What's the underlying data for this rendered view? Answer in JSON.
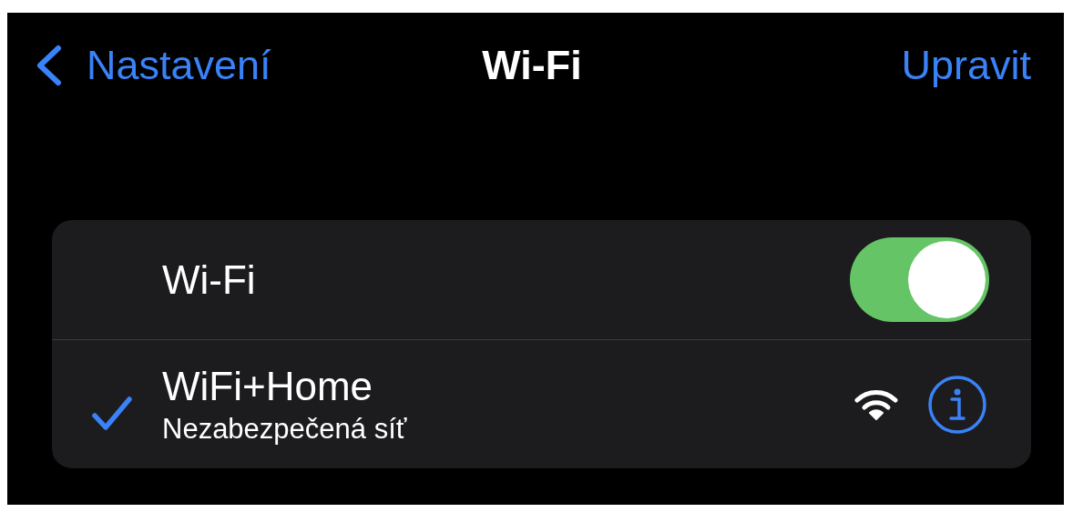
{
  "nav": {
    "back_label": "Nastavení",
    "title": "Wi-Fi",
    "action_label": "Upravit"
  },
  "wifi_toggle": {
    "label": "Wi-Fi",
    "on": true
  },
  "networks": [
    {
      "name": "WiFi+Home",
      "subtitle": "Nezabezpečená síť",
      "selected": true
    }
  ]
}
